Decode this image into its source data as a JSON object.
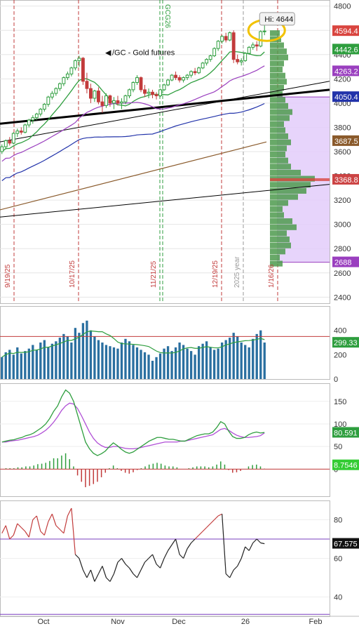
{
  "chart_data": [
    {
      "type": "candlestick",
      "title": "/GC - Gold futures",
      "contract_label": "GCG26",
      "hi_label": "Hi: 4644",
      "ylim": [
        2350,
        4850
      ],
      "y_ticks": [
        2400,
        2600,
        2800,
        3000,
        3200,
        3400,
        3600,
        3800,
        4000,
        4200,
        4400,
        4600,
        4800
      ],
      "price_badges": [
        {
          "value": "4594.4",
          "y": 4594.4,
          "color": "#d9453f"
        },
        {
          "value": "4442.6",
          "y": 4442.6,
          "color": "#2e9e3e"
        },
        {
          "value": "4263.2",
          "y": 4263.2,
          "color": "#9a3fbf"
        },
        {
          "value": "4050.4",
          "y": 4050.4,
          "color": "#2233aa"
        },
        {
          "value": "3687.5",
          "y": 3687.5,
          "color": "#8a5a2b"
        },
        {
          "value": "3368.8",
          "y": 3368.8,
          "color": "#cc4444"
        },
        {
          "value": "2688",
          "y": 2688,
          "color": "#9a3fbf"
        }
      ],
      "vertical_date_labels": [
        "9/19/25",
        "10/17/25",
        "11/21/25",
        "12/19/25",
        "2025 year",
        "1/16/26"
      ],
      "x_labels": [
        "Oct",
        "Nov",
        "Dec",
        "26",
        "Feb"
      ],
      "ohlc": [
        [
          3600,
          3660,
          3580,
          3640
        ],
        [
          3640,
          3700,
          3620,
          3690
        ],
        [
          3690,
          3720,
          3650,
          3670
        ],
        [
          3670,
          3760,
          3660,
          3750
        ],
        [
          3750,
          3790,
          3720,
          3770
        ],
        [
          3770,
          3800,
          3740,
          3760
        ],
        [
          3760,
          3830,
          3750,
          3820
        ],
        [
          3820,
          3870,
          3800,
          3860
        ],
        [
          3860,
          3900,
          3830,
          3880
        ],
        [
          3880,
          3920,
          3860,
          3910
        ],
        [
          3910,
          3960,
          3890,
          3950
        ],
        [
          3950,
          4000,
          3930,
          3990
        ],
        [
          3990,
          4060,
          3970,
          4050
        ],
        [
          4050,
          4100,
          4030,
          4080
        ],
        [
          4080,
          4130,
          4060,
          4120
        ],
        [
          4120,
          4170,
          4100,
          4160
        ],
        [
          4160,
          4220,
          4140,
          4210
        ],
        [
          4210,
          4260,
          4190,
          4240
        ],
        [
          4240,
          4300,
          4220,
          4290
        ],
        [
          4290,
          4360,
          4270,
          4350
        ],
        [
          4350,
          4390,
          4300,
          4370
        ],
        [
          4370,
          4380,
          4150,
          4180
        ],
        [
          4180,
          4250,
          4080,
          4120
        ],
        [
          4120,
          4160,
          4000,
          4040
        ],
        [
          4040,
          4110,
          4010,
          4100
        ],
        [
          4100,
          4130,
          3990,
          4010
        ],
        [
          4010,
          4060,
          3920,
          3980
        ],
        [
          3980,
          4080,
          3960,
          4060
        ],
        [
          4060,
          4070,
          3970,
          4000
        ],
        [
          4000,
          4050,
          3950,
          4020
        ],
        [
          4020,
          4060,
          3980,
          4000
        ],
        [
          4000,
          4040,
          3950,
          4010
        ],
        [
          4010,
          4070,
          3990,
          4060
        ],
        [
          4060,
          4120,
          4040,
          4110
        ],
        [
          4110,
          4180,
          4090,
          4170
        ],
        [
          4170,
          4230,
          4150,
          4210
        ],
        [
          4210,
          4220,
          4090,
          4110
        ],
        [
          4110,
          4150,
          4050,
          4080
        ],
        [
          4080,
          4120,
          4040,
          4090
        ],
        [
          4090,
          4110,
          4040,
          4070
        ],
        [
          4070,
          4090,
          4030,
          4060
        ],
        [
          4060,
          4120,
          4050,
          4110
        ],
        [
          4110,
          4160,
          4100,
          4150
        ],
        [
          4150,
          4200,
          4140,
          4190
        ],
        [
          4190,
          4240,
          4180,
          4230
        ],
        [
          4230,
          4260,
          4190,
          4210
        ],
        [
          4210,
          4230,
          4170,
          4190
        ],
        [
          4190,
          4220,
          4170,
          4210
        ],
        [
          4210,
          4240,
          4190,
          4230
        ],
        [
          4230,
          4270,
          4210,
          4260
        ],
        [
          4260,
          4290,
          4230,
          4250
        ],
        [
          4250,
          4300,
          4240,
          4290
        ],
        [
          4290,
          4340,
          4280,
          4330
        ],
        [
          4330,
          4370,
          4310,
          4360
        ],
        [
          4360,
          4400,
          4340,
          4390
        ],
        [
          4390,
          4460,
          4380,
          4450
        ],
        [
          4450,
          4520,
          4430,
          4510
        ],
        [
          4510,
          4560,
          4490,
          4550
        ],
        [
          4550,
          4580,
          4500,
          4520
        ],
        [
          4520,
          4590,
          4510,
          4580
        ],
        [
          4580,
          4600,
          4330,
          4360
        ],
        [
          4360,
          4400,
          4320,
          4340
        ],
        [
          4340,
          4370,
          4310,
          4350
        ],
        [
          4350,
          4420,
          4340,
          4410
        ],
        [
          4410,
          4470,
          4400,
          4460
        ],
        [
          4460,
          4500,
          4440,
          4480
        ],
        [
          4480,
          4510,
          4430,
          4470
        ],
        [
          4470,
          4600,
          4460,
          4590
        ],
        [
          4590,
          4644,
          4560,
          4594
        ]
      ],
      "volume_profile": {
        "bins_low": 2650,
        "bin_size": 50,
        "widths": [
          18,
          14,
          22,
          30,
          28,
          24,
          38,
          32,
          20,
          18,
          26,
          40,
          52,
          58,
          64,
          44,
          30,
          26,
          22,
          24,
          30,
          26,
          22,
          20,
          28,
          32,
          26,
          22,
          18,
          20,
          24,
          22,
          18,
          20,
          26,
          24,
          20,
          16,
          14
        ]
      },
      "volume_profile_poc": 3368.8,
      "value_area": [
        2688,
        4050.4
      ]
    },
    {
      "type": "volume",
      "ylim": [
        0,
        600
      ],
      "y_ticks": [
        0,
        200,
        400
      ],
      "value_label": "299.33",
      "reference_line": 350,
      "values": [
        180,
        220,
        240,
        200,
        260,
        210,
        230,
        250,
        280,
        240,
        300,
        320,
        260,
        290,
        310,
        340,
        370,
        350,
        300,
        420,
        380,
        460,
        480,
        400,
        350,
        320,
        300,
        280,
        270,
        260,
        250,
        300,
        330,
        310,
        280,
        260,
        240,
        220,
        200,
        150,
        180,
        210,
        250,
        270,
        230,
        260,
        300,
        280,
        250,
        230,
        200,
        270,
        290,
        310,
        260,
        240,
        250,
        300,
        320,
        340,
        380,
        350,
        300,
        280,
        260,
        330,
        370,
        400,
        300
      ]
    },
    {
      "type": "indicator",
      "ylim": [
        -60,
        190
      ],
      "y_ticks": [
        0,
        50,
        100,
        150
      ],
      "value_label_1": "80.591",
      "value_label_2": "8.7546",
      "line_1": [
        60,
        62,
        64,
        65,
        68,
        70,
        74,
        76,
        80,
        86,
        92,
        100,
        112,
        128,
        140,
        160,
        175,
        168,
        150,
        120,
        90,
        60,
        45,
        35,
        30,
        34,
        40,
        50,
        58,
        52,
        44,
        38,
        35,
        38,
        44,
        50,
        56,
        62,
        66,
        70,
        70,
        68,
        66,
        66,
        64,
        62,
        62,
        66,
        70,
        74,
        76,
        78,
        78,
        82,
        92,
        105,
        100,
        84,
        72,
        68,
        68,
        70,
        76,
        80,
        82,
        80,
        81
      ],
      "line_2": [
        60,
        60,
        62,
        63,
        64,
        66,
        68,
        70,
        72,
        75,
        80,
        86,
        94,
        104,
        116,
        130,
        140,
        146,
        144,
        134,
        118,
        100,
        82,
        68,
        58,
        52,
        48,
        48,
        50,
        50,
        48,
        46,
        45,
        45,
        46,
        48,
        50,
        52,
        54,
        56,
        58,
        60,
        60,
        60,
        60,
        62,
        62,
        64,
        66,
        68,
        70,
        72,
        74,
        76,
        82,
        88,
        90,
        86,
        80,
        75,
        72,
        70,
        70,
        71,
        72,
        74,
        80
      ]
    },
    {
      "type": "rsi",
      "ylim": [
        30,
        90
      ],
      "y_ticks": [
        40,
        60,
        80
      ],
      "value_label": "67.575",
      "reference_line": 70,
      "values": [
        73,
        77,
        70,
        72,
        78,
        76,
        74,
        71,
        80,
        82,
        74,
        72,
        79,
        83,
        77,
        75,
        73,
        82,
        86,
        62,
        60,
        54,
        50,
        54,
        48,
        52,
        56,
        50,
        48,
        52,
        58,
        60,
        57,
        55,
        52,
        50,
        54,
        58,
        60,
        62,
        57,
        55,
        60,
        64,
        67,
        70,
        62,
        60,
        65,
        68,
        70,
        72,
        74,
        76,
        78,
        80,
        82,
        83,
        52,
        50,
        54,
        56,
        60,
        66,
        64,
        68,
        70,
        68,
        67.6
      ]
    }
  ]
}
